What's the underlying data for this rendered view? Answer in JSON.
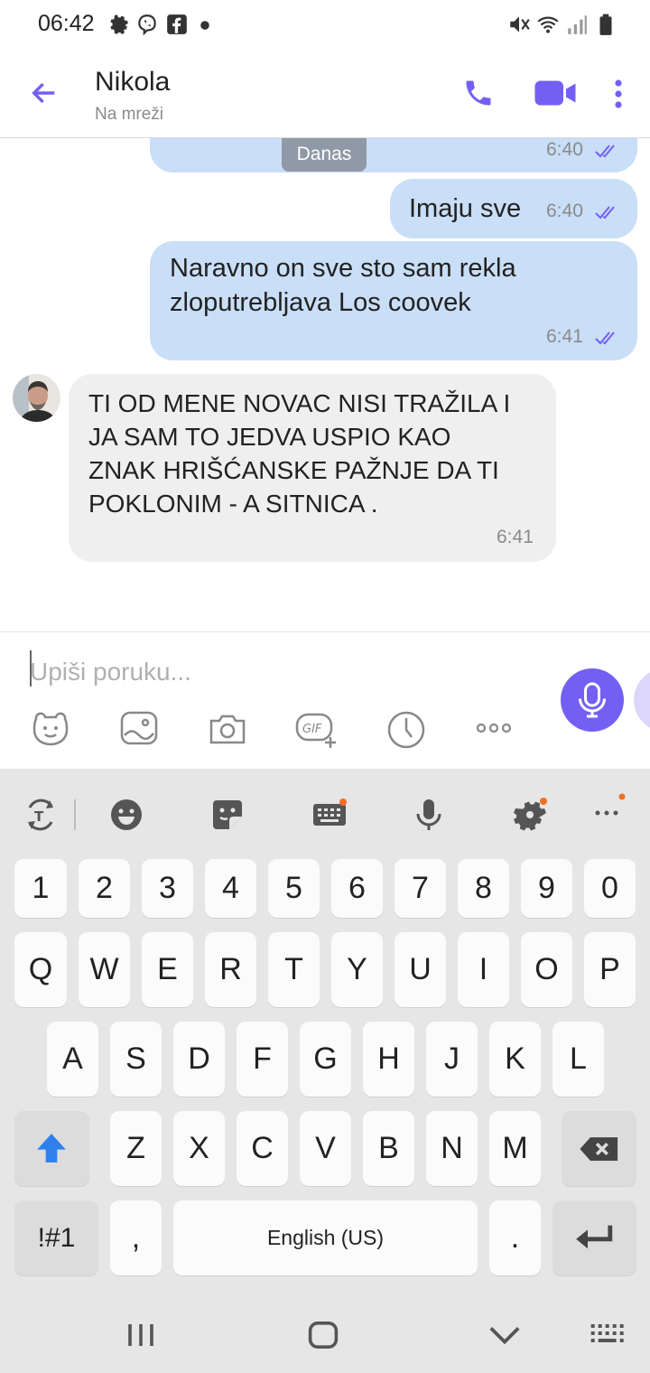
{
  "status_bar": {
    "time": "06:42",
    "left_icons": [
      "gear-icon",
      "viber-icon",
      "facebook-icon",
      "dot-icon"
    ],
    "right_icons": [
      "mute-icon",
      "wifi-icon",
      "signal-icon",
      "battery-icon"
    ]
  },
  "header": {
    "contact_name": "Nikola",
    "contact_status": "Na mreži",
    "accent": "#7360f2"
  },
  "chat": {
    "date_chip": "Danas",
    "messages": [
      {
        "direction": "outgoing",
        "text": "",
        "time": "6:40",
        "read": true
      },
      {
        "direction": "outgoing",
        "text": "Imaju sve",
        "time": "6:40",
        "read": true
      },
      {
        "direction": "outgoing",
        "text_lines": [
          "Naravno on sve sto sam rekla",
          "zloputrebljava Los coovek"
        ],
        "time": "6:41",
        "read": true
      },
      {
        "direction": "incoming",
        "text_lines": [
          "TI OD MENE NOVAC NISI TRAŽILA I",
          "JA SAM TO JEDVA USPIO KAO",
          "ZNAK HRIŠĆANSKE PAŽNJE DA TI",
          "POKLONIM - A SITNICA ."
        ],
        "time": "6:41"
      }
    ]
  },
  "composer": {
    "placeholder": "Upiši poruku...",
    "tools": [
      "sticker-icon",
      "gallery-icon",
      "camera-icon",
      "gif-icon",
      "timer-icon",
      "more-icon"
    ],
    "gif_label": "GIF"
  },
  "keyboard": {
    "toolbar": [
      "text-mode-icon",
      "emoji-icon",
      "sticker-icon",
      "keyboard-settings-icon",
      "voice-icon",
      "settings-icon",
      "more-icon"
    ],
    "row_numbers": [
      "1",
      "2",
      "3",
      "4",
      "5",
      "6",
      "7",
      "8",
      "9",
      "0"
    ],
    "row1": [
      "Q",
      "W",
      "E",
      "R",
      "T",
      "Y",
      "U",
      "I",
      "O",
      "P"
    ],
    "row2": [
      "A",
      "S",
      "D",
      "F",
      "G",
      "H",
      "J",
      "K",
      "L"
    ],
    "row3": [
      "Z",
      "X",
      "C",
      "V",
      "B",
      "N",
      "M"
    ],
    "symbols_key": "!#1",
    "comma_key": ",",
    "space_label": "English (US)",
    "period_key": "."
  },
  "navbar": {
    "buttons": [
      "recents-button",
      "home-button",
      "back-button",
      "keyboard-switch-button"
    ]
  }
}
